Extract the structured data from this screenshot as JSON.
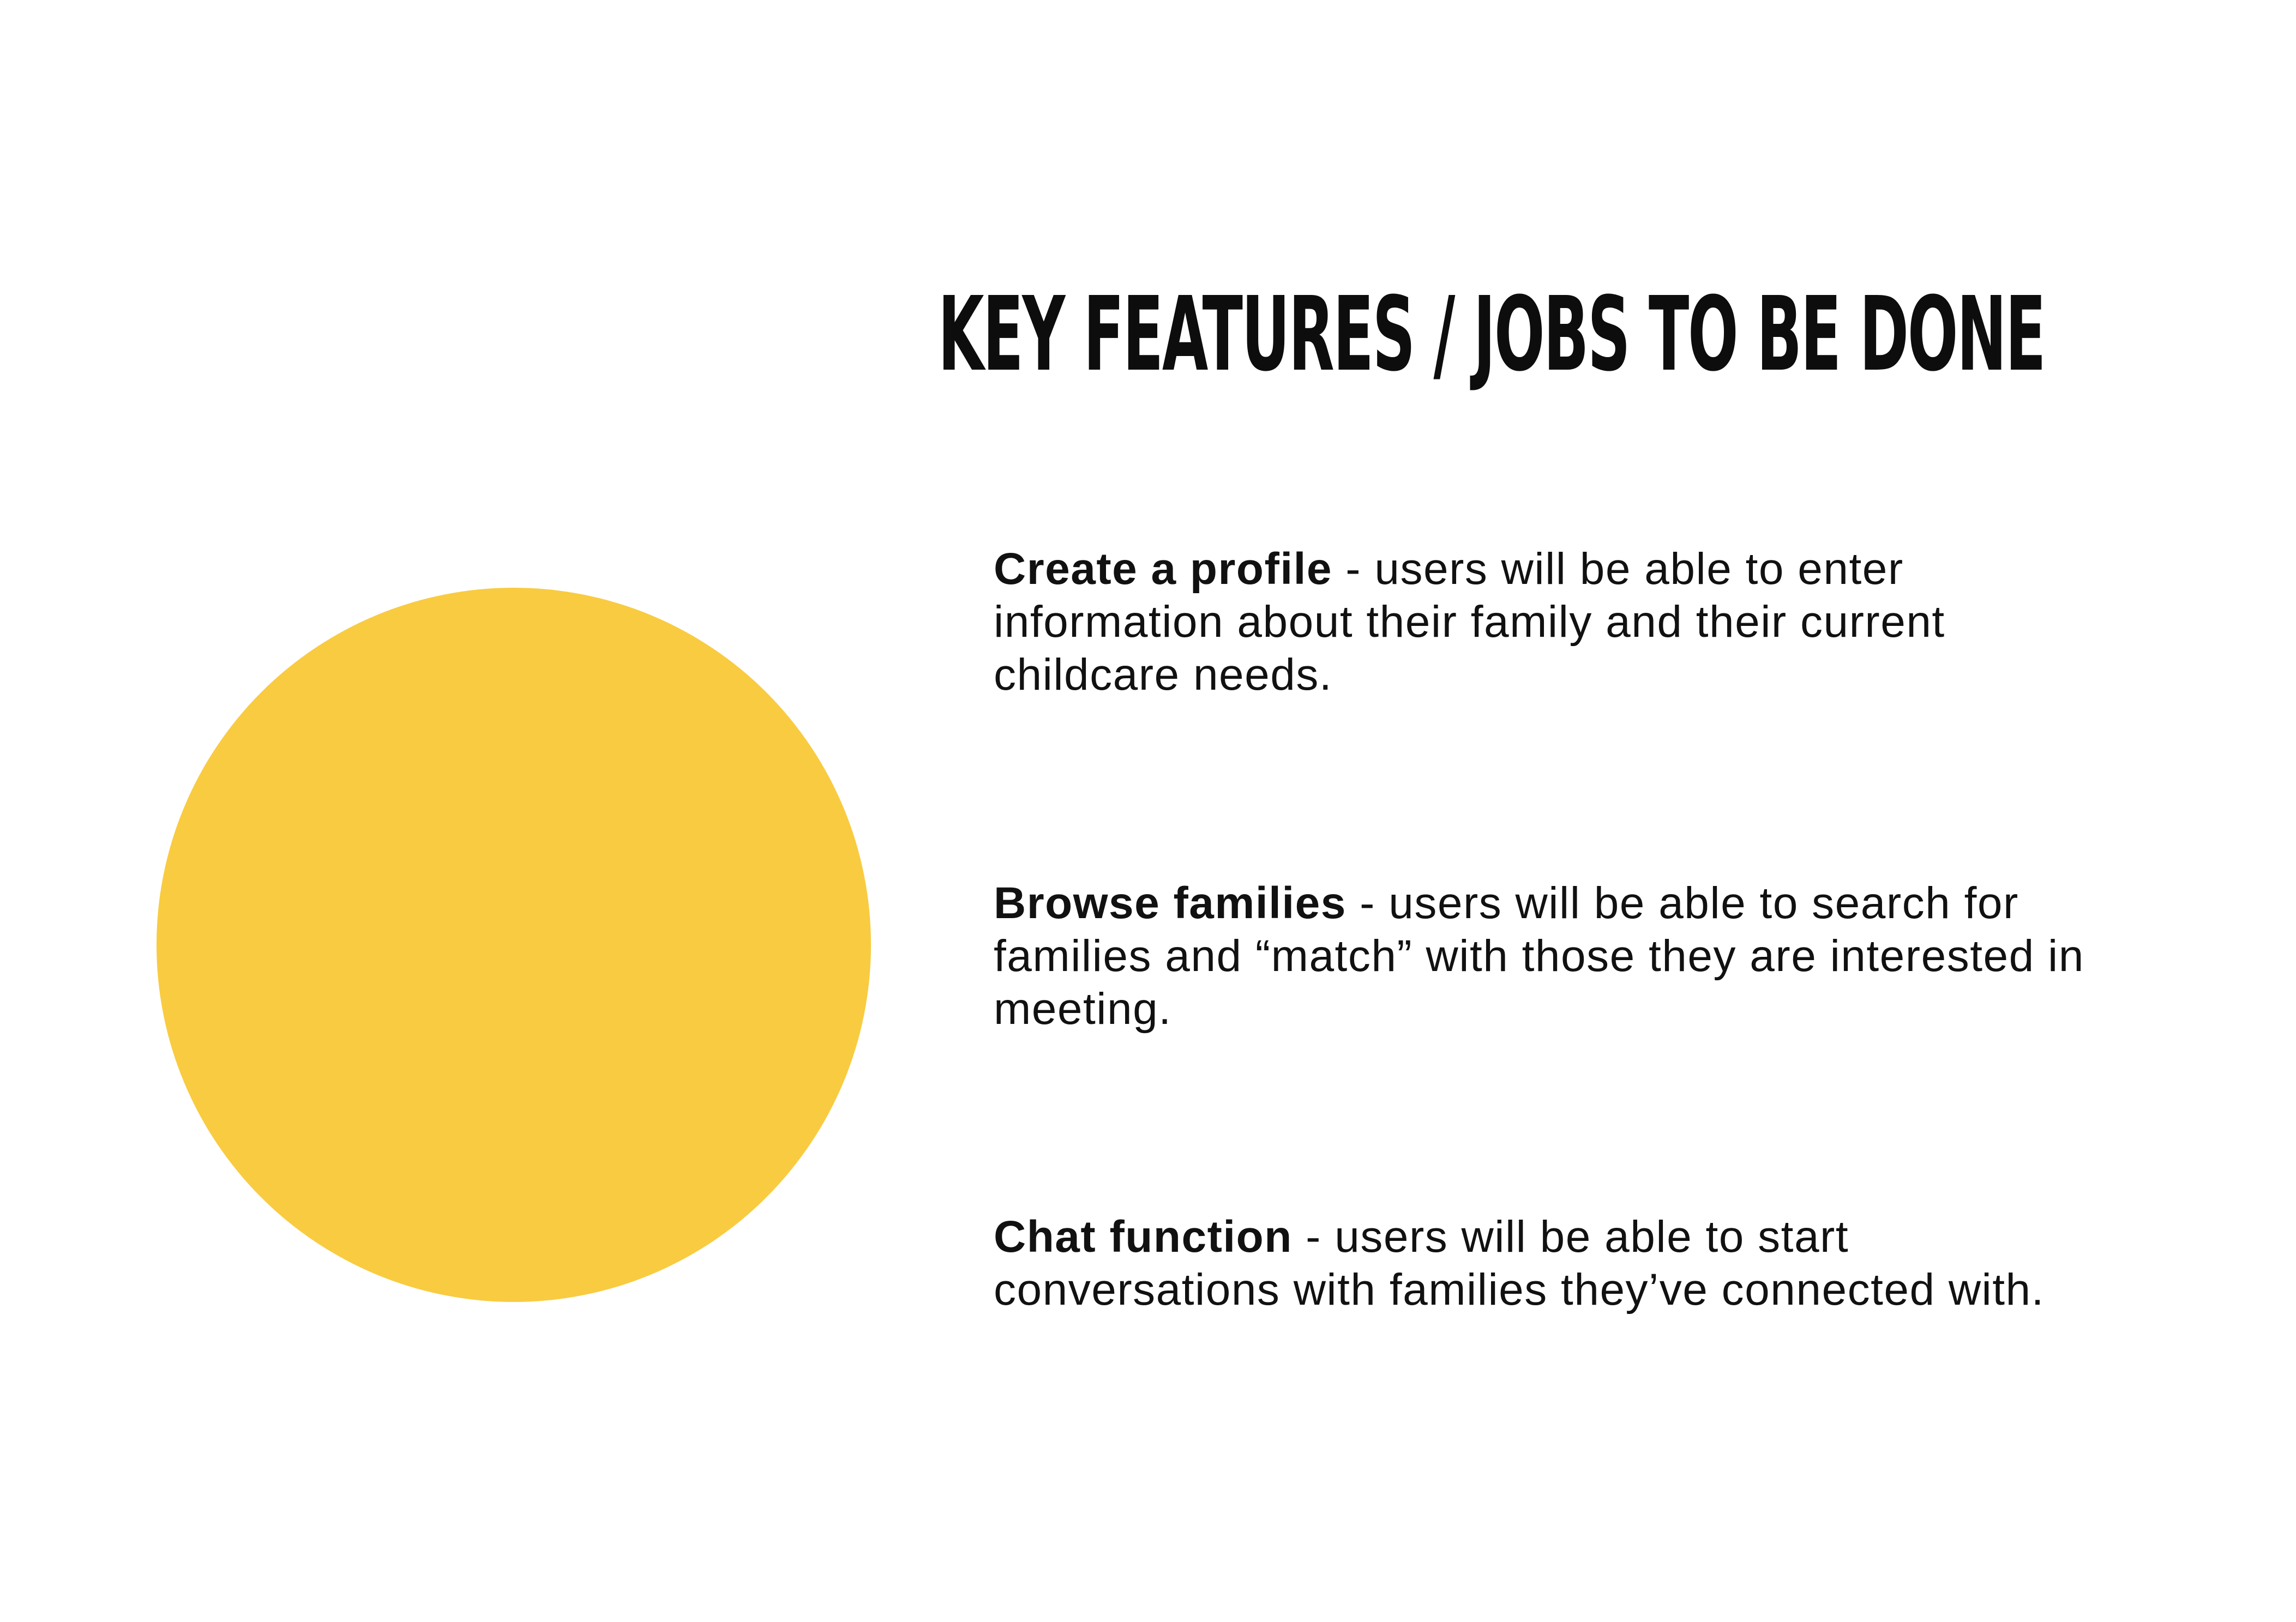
{
  "title": "KEY FEATURES / JOBS TO BE DONE",
  "colors": {
    "accent_circle": "#f9cb40",
    "text": "#111111",
    "background": "#ffffff"
  },
  "features": [
    {
      "name": "Create a profile",
      "description": " - users will be able to enter information about their family and their current childcare needs."
    },
    {
      "name": "Browse families",
      "description": " - users will be able to search for families and “match” with those they are interested in meeting."
    },
    {
      "name": "Chat function",
      "description": " - users will be able to start conversations with families they’ve connected with."
    }
  ]
}
